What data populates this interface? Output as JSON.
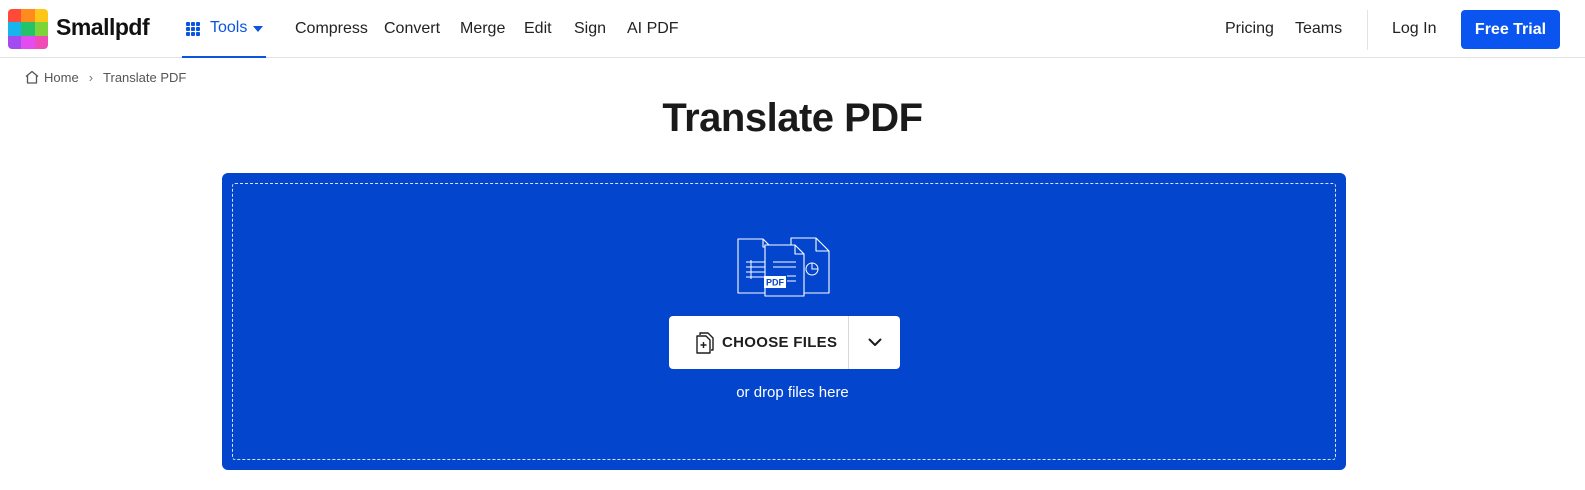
{
  "brand": {
    "name": "Smallpdf",
    "logo_colors": [
      "#ff4a3a",
      "#ff8a1e",
      "#ffc61a",
      "#18b4ee",
      "#23c26b",
      "#7cd43a",
      "#a24cf0",
      "#e24cf0",
      "#f04cb8"
    ]
  },
  "nav": {
    "tools_label": "Tools",
    "links": [
      "Compress",
      "Convert",
      "Merge",
      "Edit",
      "Sign",
      "AI PDF"
    ],
    "right_links": [
      "Pricing",
      "Teams"
    ],
    "login_label": "Log In",
    "cta_label": "Free Trial"
  },
  "breadcrumb": {
    "home": "Home",
    "separator": "›",
    "current": "Translate PDF"
  },
  "page": {
    "title": "Translate PDF"
  },
  "dropzone": {
    "choose_label": "CHOOSE FILES",
    "hint": "or drop files here",
    "illustration_badge": "PDF"
  },
  "colors": {
    "accent": "#0a55e0",
    "cta": "#0a55f0",
    "dropzone": "#0345cc"
  },
  "icons": [
    "tools-grid-icon",
    "caret-down-icon",
    "home-icon",
    "file-add-icon",
    "chevron-down-icon"
  ]
}
